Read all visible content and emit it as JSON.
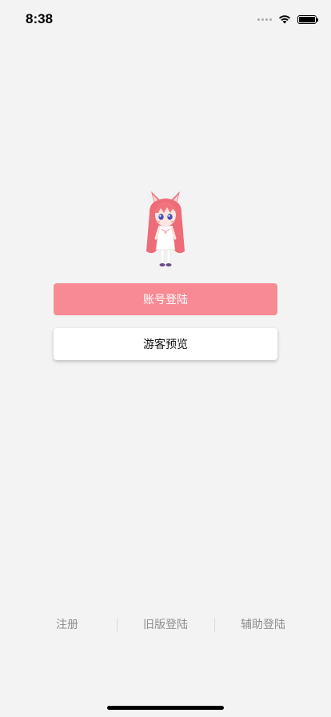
{
  "status_bar": {
    "time": "8:38",
    "icons": [
      "signal-icon",
      "wifi-icon",
      "battery-icon"
    ]
  },
  "mascot": {
    "icon": "anime-girl-mascot"
  },
  "buttons": {
    "account_login": "账号登陆",
    "guest_preview": "游客预览"
  },
  "footer": {
    "register": "注册",
    "old_version_login": "旧版登陆",
    "assisted_login": "辅助登陆"
  },
  "colors": {
    "background": "#f3f3f3",
    "primary_button": "#f78a93",
    "footer_text": "#8e8e8e"
  }
}
